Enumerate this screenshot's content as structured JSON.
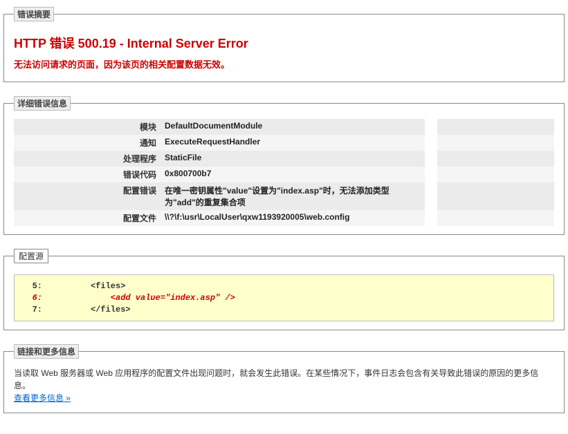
{
  "summary": {
    "legend": "错误摘要",
    "title": "HTTP 错误 500.19 - Internal Server Error",
    "subtitle": "无法访问请求的页面，因为该页的相关配置数据无效。"
  },
  "details": {
    "legend": "详细错误信息",
    "rows": [
      {
        "label": "模块",
        "value": "DefaultDocumentModule"
      },
      {
        "label": "通知",
        "value": "ExecuteRequestHandler"
      },
      {
        "label": "处理程序",
        "value": "StaticFile"
      },
      {
        "label": "错误代码",
        "value": "0x800700b7"
      },
      {
        "label": "配置错误",
        "value": "在唯一密钥属性\"value\"设置为\"index.asp\"时，无法添加类型为\"add\"的重复集合项"
      },
      {
        "label": "配置文件",
        "value": "\\\\?\\f:\\usr\\LocalUser\\qxw1193920005\\web.config"
      }
    ]
  },
  "configSource": {
    "legend": "配置源",
    "lines": [
      {
        "num": "5:",
        "text": "<files>",
        "hl": false
      },
      {
        "num": "6:",
        "text": "    <add value=\"index.asp\" />",
        "hl": true
      },
      {
        "num": "7:",
        "text": "</files>",
        "hl": false
      }
    ]
  },
  "moreInfo": {
    "legend": "链接和更多信息",
    "text": "当读取 Web 服务器或 Web 应用程序的配置文件出现问题时，就会发生此错误。在某些情况下，事件日志会包含有关导致此错误的原因的更多信息。",
    "linkText": "查看更多信息 »"
  }
}
